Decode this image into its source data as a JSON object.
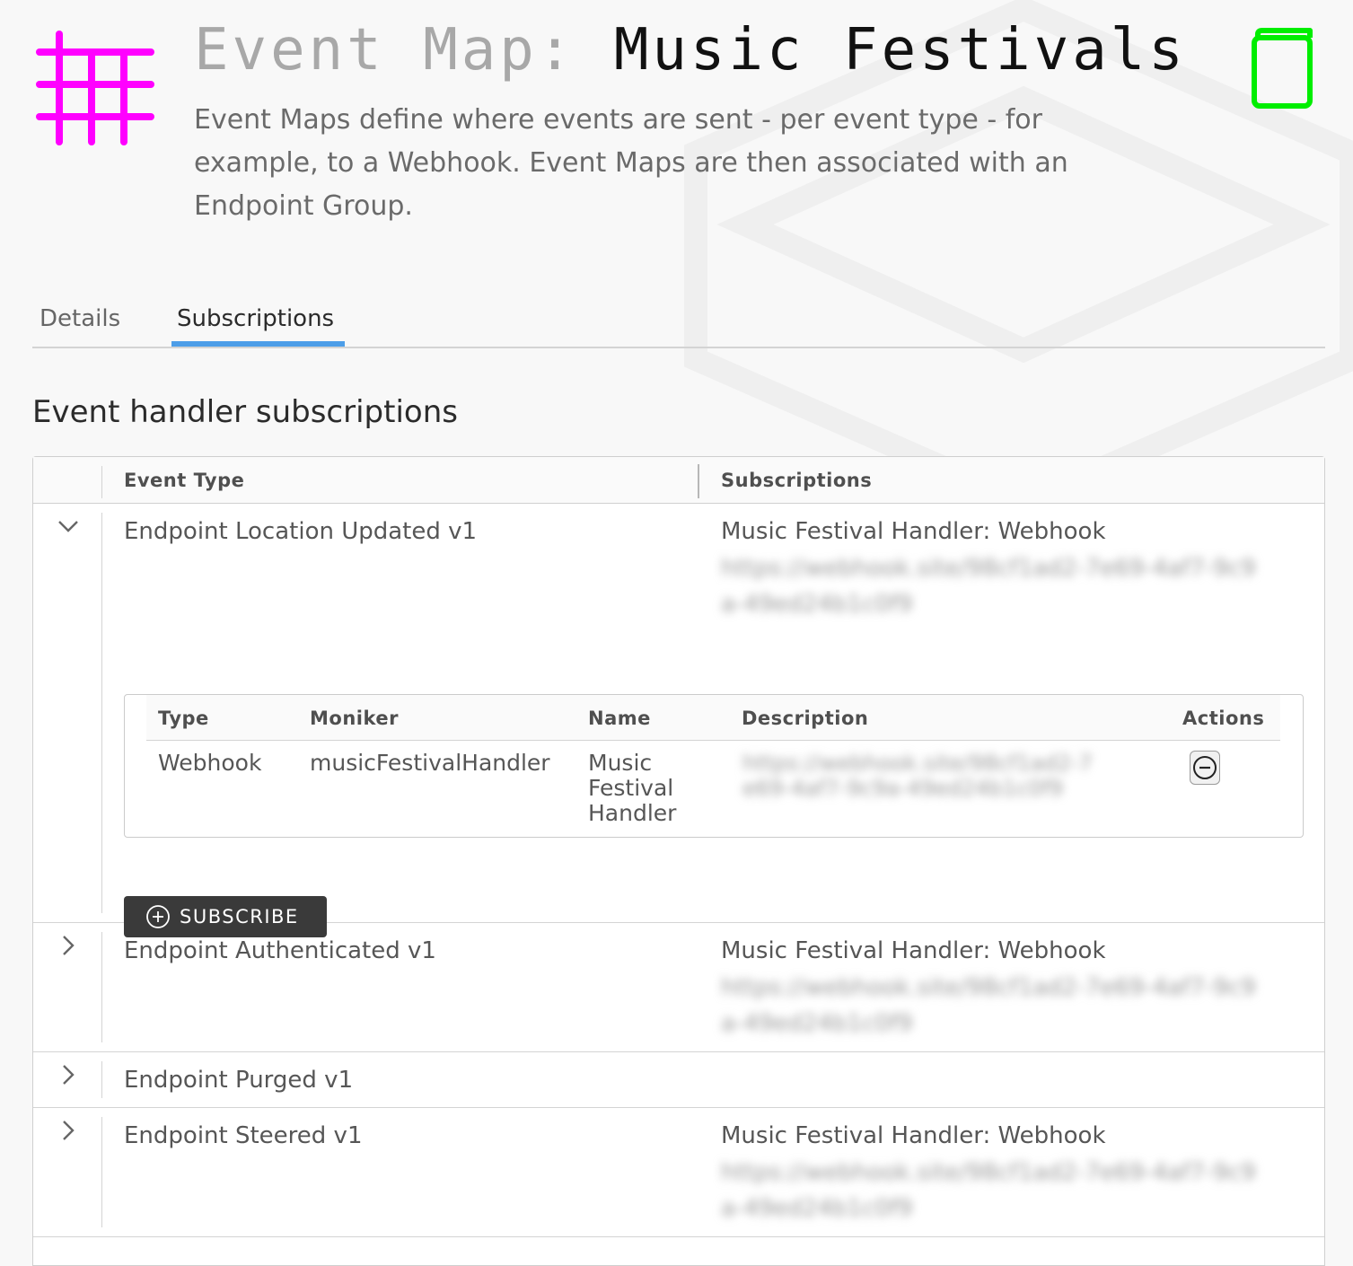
{
  "header": {
    "title_prefix": "Event Map:",
    "title_name": "Music Festivals",
    "description": "Event Maps define where events are sent - per event type - for example, to a Webhook. Event Maps are then associated with an Endpoint Group.",
    "icon": "grid-icon",
    "docs_icon": "book-icon"
  },
  "colors": {
    "grid_icon": "#ff00ff",
    "book_icon": "#00ee00",
    "tab_accent": "#4d9ee8",
    "subscribe_button_bg": "#3a3a3a"
  },
  "tabs": [
    {
      "label": "Details",
      "active": false
    },
    {
      "label": "Subscriptions",
      "active": true
    }
  ],
  "section_title": "Event handler subscriptions",
  "table": {
    "columns": [
      "Event Type",
      "Subscriptions"
    ],
    "rows": [
      {
        "event_type": "Endpoint Location Updated v1",
        "expanded": true,
        "subscription_name": "Music Festival Handler: Webhook",
        "subscription_url": "https://webhook.site/98cf1ad2-7e69-4af7-9c9a-49ed24b1c0f9",
        "details": {
          "columns": [
            "Type",
            "Moniker",
            "Name",
            "Description",
            "Actions"
          ],
          "rows": [
            {
              "type": "Webhook",
              "moniker": "musicFestivalHandler",
              "name": "Music Festival Handler",
              "description": "https://webhook.site/98cf1ad2-7e69-4af7-9c9a-49ed24b1c0f9",
              "action_icon": "minus-circle-icon"
            }
          ],
          "subscribe_label": "SUBSCRIBE",
          "subscribe_icon": "plus-circle-icon"
        }
      },
      {
        "event_type": "Endpoint Authenticated v1",
        "expanded": false,
        "subscription_name": "Music Festival Handler: Webhook",
        "subscription_url": "https://webhook.site/98cf1ad2-7e69-4af7-9c9a-49ed24b1c0f9"
      },
      {
        "event_type": "Endpoint Purged v1",
        "expanded": false,
        "subscription_name": "",
        "subscription_url": ""
      },
      {
        "event_type": "Endpoint Steered v1",
        "expanded": false,
        "subscription_name": "Music Festival Handler: Webhook",
        "subscription_url": "https://webhook.site/98cf1ad2-7e69-4af7-9c9a-49ed24b1c0f9"
      }
    ]
  }
}
